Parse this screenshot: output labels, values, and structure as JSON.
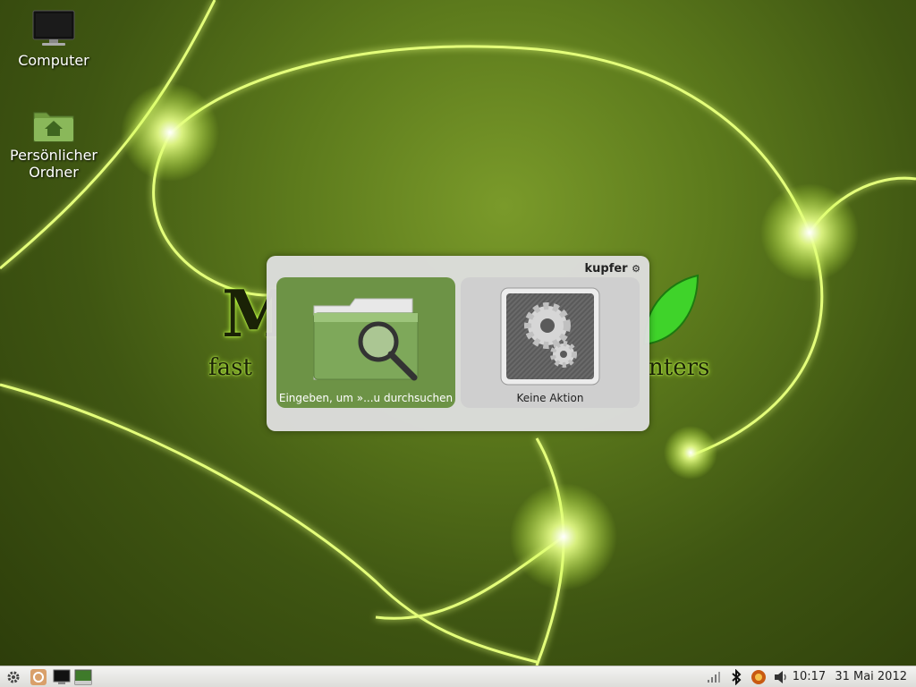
{
  "desktop": {
    "icons": [
      {
        "label": "Computer",
        "icon": "monitor-icon"
      },
      {
        "label": "Persönlicher Ordner",
        "icon": "home-folder-icon"
      }
    ],
    "wallpaper": {
      "logo_letter": "M",
      "tagline_left": "fast",
      "tagline_right": "nters",
      "accent": "#c8ff3c"
    }
  },
  "kupfer": {
    "title": "kupfer",
    "object_pane": {
      "label": "Eingeben, um »...u durchsuchen",
      "icon": "folder-search-icon"
    },
    "action_pane": {
      "label": "Keine Aktion",
      "icon": "gears-icon"
    },
    "colors": {
      "object_bg": "#6d9346",
      "window_bg": "#dedede"
    }
  },
  "panel": {
    "launchers": [
      "settings-icon",
      "mail-icon",
      "terminal-icon",
      "desktop-icon"
    ],
    "tray": [
      "network-icon",
      "bluetooth-icon",
      "update-icon",
      "volume-icon"
    ],
    "time": "10:17",
    "date": "31 Mai 2012"
  }
}
